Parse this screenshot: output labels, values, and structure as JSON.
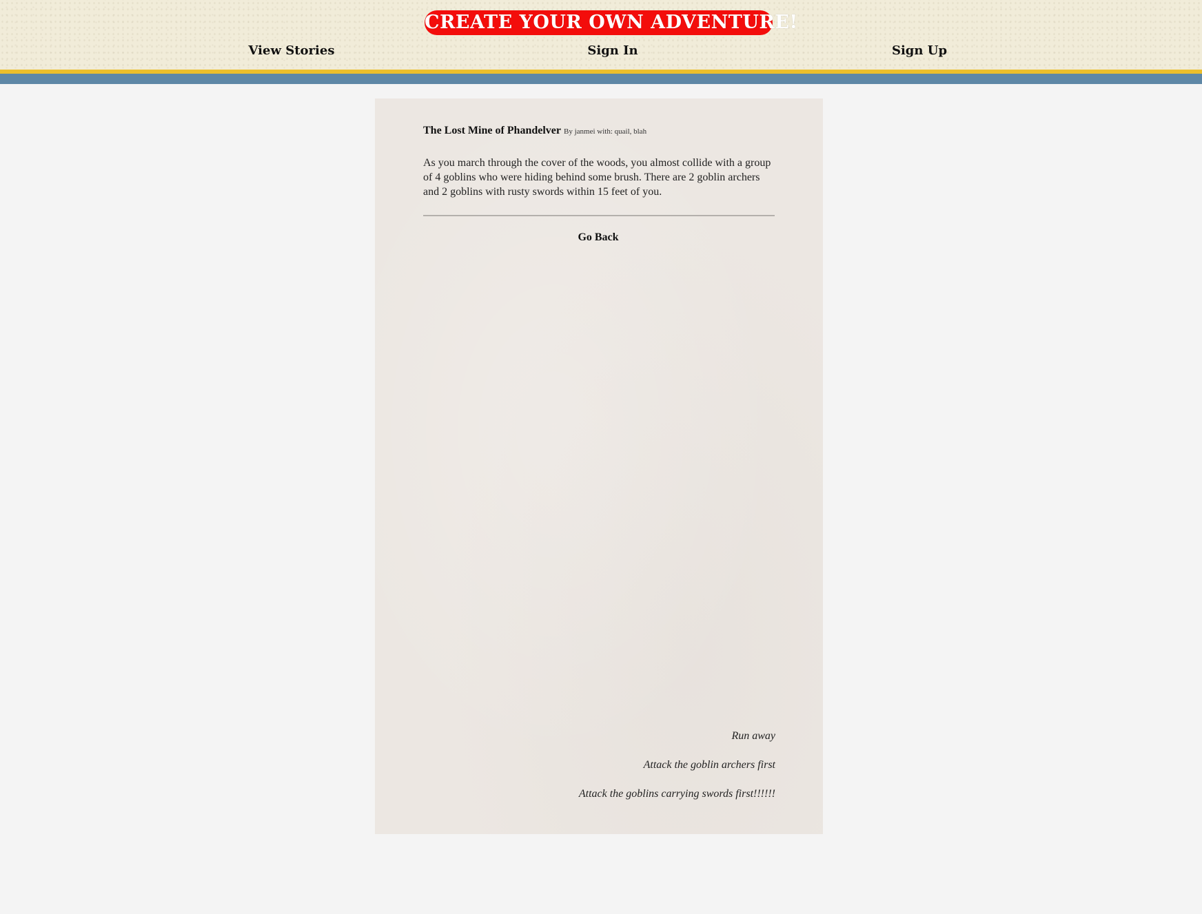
{
  "header": {
    "logo_text": "CREATE YOUR OWN ADVENTURE!",
    "nav": {
      "view_stories": "View Stories",
      "sign_in": "Sign In",
      "sign_up": "Sign Up"
    }
  },
  "story": {
    "title": "The Lost Mine of Phandelver",
    "byline": "By janmei with: quail, blah",
    "text": "As you march through the cover of the woods, you almost collide with a group of 4 goblins who were hiding behind some brush. There are 2 goblin archers and 2 goblins with rusty swords within 15 feet of you.",
    "go_back_label": "Go Back",
    "choices": [
      {
        "label": "Run away"
      },
      {
        "label": "Attack the goblin archers first"
      },
      {
        "label": "Attack the goblins carrying swords first!!!!!!"
      }
    ]
  },
  "colors": {
    "header_bg": "#f1ecd9",
    "logo_bg": "#f30d0b",
    "stripe_yellow": "#ebbe2c",
    "stripe_blue": "#5e87a6",
    "page_bg": "#f4f4f4",
    "card_bg": "#ece7e2"
  }
}
